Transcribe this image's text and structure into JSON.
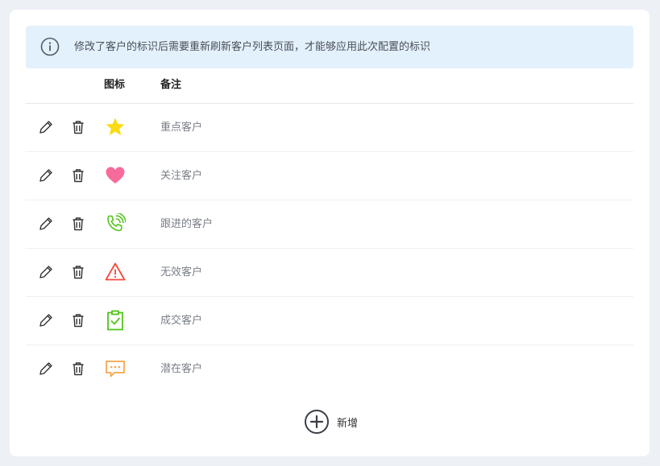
{
  "notice": {
    "text": "修改了客户的标识后需要重新刷新客户列表页面，才能够应用此次配置的标识",
    "icon": "info-circle-icon"
  },
  "table": {
    "columns": [
      "",
      "图标",
      "备注"
    ],
    "rows": [
      {
        "icon": "star-icon",
        "icon_color": "#fadb14",
        "note": "重点客户"
      },
      {
        "icon": "heart-icon",
        "icon_color": "#f76b9c",
        "note": "关注客户"
      },
      {
        "icon": "phone-call-icon",
        "icon_color": "#52c41a",
        "note": "跟进的客户"
      },
      {
        "icon": "warning-triangle-icon",
        "icon_color": "#f5483b",
        "note": "无效客户"
      },
      {
        "icon": "clipboard-check-icon",
        "icon_color": "#52c41a",
        "note": "成交客户"
      },
      {
        "icon": "chat-bubble-icon",
        "icon_color": "#f7a24a",
        "note": "潜在客户"
      }
    ],
    "row_actions": [
      "edit-pencil-icon",
      "delete-trash-icon"
    ]
  },
  "add_button": {
    "label": "新增",
    "icon": "plus-circle-icon"
  }
}
